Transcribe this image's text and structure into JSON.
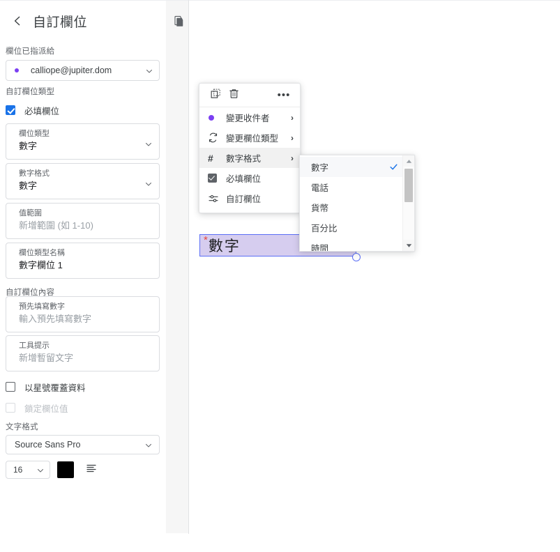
{
  "panel": {
    "title": "自訂欄位",
    "back_icon": "chevron-left-icon",
    "assigned_label": "欄位已指派給",
    "assignee": {
      "value": "calliope@jupiter.dom",
      "dot_color": "#7b3ff2",
      "chevron": "chevron-down-icon"
    },
    "field_type_section_label": "自訂欄位類型",
    "required_checkbox": {
      "label": "必填欄位",
      "checked": true,
      "color": "#1a73e8"
    },
    "fields": [
      {
        "label": "欄位類型",
        "value": "數字",
        "placeholder": false,
        "chevron": true
      },
      {
        "label": "數字格式",
        "value": "數字",
        "placeholder": false,
        "chevron": true
      },
      {
        "label": "值範圍",
        "value": "新增範圍 (如 1-10)",
        "placeholder": true,
        "chevron": false
      },
      {
        "label": "欄位類型名稱",
        "value": "數字欄位 1",
        "placeholder": false,
        "chevron": false
      }
    ],
    "content_section_label": "自訂欄位內容",
    "content_fields": [
      {
        "label": "預先填寫數字",
        "value": "輸入預先填寫數字",
        "placeholder": true
      },
      {
        "label": "工具提示",
        "value": "新增暫留文字",
        "placeholder": true
      }
    ],
    "mask_checkbox": {
      "label": "以星號覆蓋資料",
      "checked": false,
      "disabled": false
    },
    "lock_checkbox": {
      "label": "鎖定欄位值",
      "checked": false,
      "disabled": true
    },
    "text_format_label": "文字格式",
    "font_family": "Source Sans Pro",
    "font_size": "16",
    "font_color": "#000000",
    "align_icon": "align-left-icon"
  },
  "canvas": {
    "page_icon": "duplicate-pages-icon",
    "field_widget": {
      "required_marker": "*",
      "text": "數字",
      "fill_color": "#d6cdef",
      "border_color": "#5b6ef5"
    }
  },
  "context_menu": {
    "toolbar": [
      {
        "icon": "duplicate-icon",
        "name": "duplicate-button"
      },
      {
        "icon": "trash-icon",
        "name": "delete-button"
      },
      {
        "icon": "more-icon",
        "label": "•••",
        "name": "more-options-button"
      }
    ],
    "items": [
      {
        "label": "變更收件者",
        "icon": "recipient-dot-icon",
        "has_submenu": true,
        "highlighted": false
      },
      {
        "label": "變更欄位類型",
        "icon": "refresh-icon",
        "has_submenu": true,
        "highlighted": false
      },
      {
        "label": "數字格式",
        "icon": "hash-icon",
        "has_submenu": true,
        "highlighted": true
      },
      {
        "label": "必填欄位",
        "icon": "checkbox-checked-icon",
        "has_submenu": false,
        "highlighted": false
      },
      {
        "label": "自訂欄位",
        "icon": "sliders-icon",
        "has_submenu": false,
        "highlighted": false
      }
    ],
    "arrow": "›"
  },
  "submenu": {
    "items": [
      {
        "label": "數字",
        "selected": true
      },
      {
        "label": "電話",
        "selected": false
      },
      {
        "label": "貨幣",
        "selected": false
      },
      {
        "label": "百分比",
        "selected": false
      },
      {
        "label": "時間",
        "selected": false
      }
    ],
    "check_icon": "check-icon",
    "check_color": "#1a73e8",
    "scrollbar": {
      "up_icon": "scroll-up-arrow-icon",
      "down_icon": "scroll-down-arrow-icon"
    }
  }
}
